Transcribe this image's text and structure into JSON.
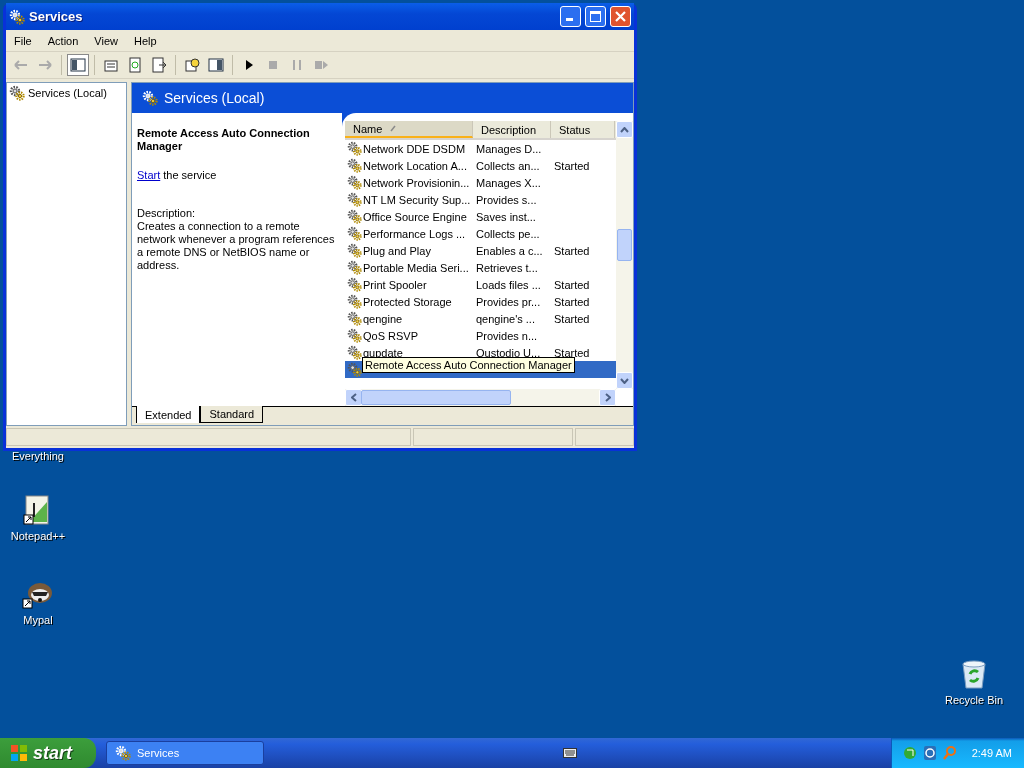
{
  "window": {
    "title": "Services"
  },
  "menu": [
    "File",
    "Action",
    "View",
    "Help"
  ],
  "tree": {
    "items": [
      {
        "label": "Services (Local)",
        "selected": false
      }
    ]
  },
  "header": {
    "title": "Services (Local)"
  },
  "details": {
    "service_name": "Remote Access Auto Connection Manager",
    "action_link": "Start",
    "action_text": "the service",
    "description_label": "Description:",
    "description": "Creates a connection to a remote network whenever a program references a remote DNS or NetBIOS name or address."
  },
  "table": {
    "columns": [
      {
        "label": "Name",
        "sorted": true
      },
      {
        "label": "Description",
        "sorted": false
      },
      {
        "label": "Status",
        "sorted": false
      }
    ],
    "rows": [
      {
        "name": "Network DDE DSDM",
        "description": "Manages D...",
        "selected": false
      },
      {
        "name": "Network Location A...",
        "description": "Collects an...",
        "status": "Started",
        "selected": false
      },
      {
        "name": "Network Provisionin...",
        "description": "Manages X...",
        "selected": false
      },
      {
        "name": "NT LM Security Sup...",
        "description": "Provides s...",
        "selected": false
      },
      {
        "name": "Office Source Engine",
        "description": "Saves inst...",
        "selected": false
      },
      {
        "name": "Performance Logs ...",
        "description": "Collects pe...",
        "selected": false
      },
      {
        "name": "Plug and Play",
        "description": "Enables a c...",
        "status": "Started",
        "selected": false
      },
      {
        "name": "Portable Media Seri...",
        "description": "Retrieves t...",
        "selected": false
      },
      {
        "name": "Print Spooler",
        "description": "Loads files ...",
        "status": "Started",
        "selected": false
      },
      {
        "name": "Protected Storage",
        "description": "Provides pr...",
        "status": "Started",
        "selected": false
      },
      {
        "name": "qengine",
        "description": "qengine's ...",
        "status": "Started",
        "selected": false
      },
      {
        "name": "QoS RSVP",
        "description": "Provides n...",
        "selected": false
      },
      {
        "name": "qupdate",
        "description": "Qustodio U...",
        "status": "Started",
        "selected": false
      },
      {
        "selected": true
      }
    ],
    "tooltip": "Remote Access Auto Connection Manager"
  },
  "view_tabs": [
    {
      "label": "Extended",
      "selected": true
    },
    {
      "label": "Standard",
      "selected": false
    }
  ],
  "desktop_icons": [
    {
      "label": "Everything",
      "kind": "hidden"
    },
    {
      "label": "Notepad++",
      "kind": "notepad"
    },
    {
      "label": "Mypal",
      "kind": "mypal"
    },
    {
      "label": "Recycle Bin",
      "kind": "recycle"
    }
  ],
  "taskbar": {
    "start": "start",
    "tasks": [
      {
        "label": "Services",
        "selected": false
      }
    ],
    "clock": "2:49 AM"
  }
}
